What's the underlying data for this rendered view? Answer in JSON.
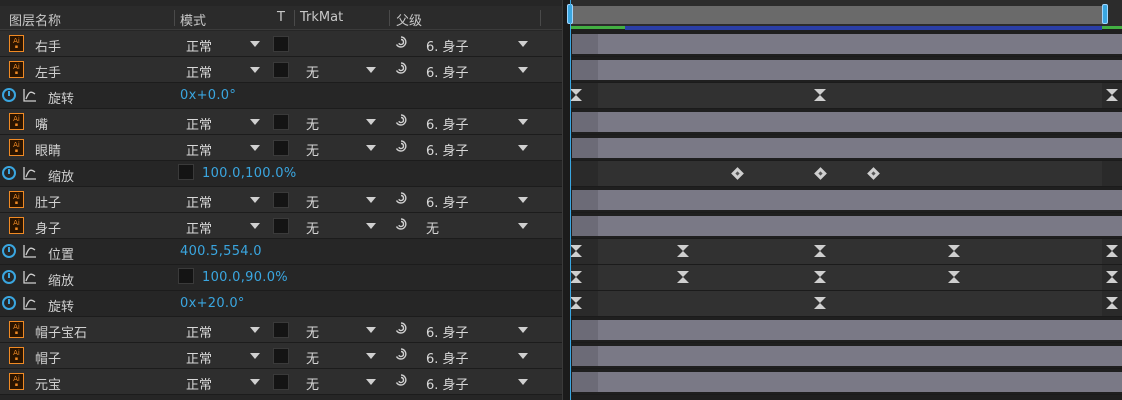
{
  "header": {
    "layer_name": "图层名称",
    "mode": "模式",
    "t": "T",
    "trkmat": "TrkMat",
    "parent": "父级"
  },
  "rows": [
    {
      "kind": "layer",
      "name": "右手",
      "mode": "正常",
      "trkmat": "",
      "parent": "6. 身子"
    },
    {
      "kind": "layer",
      "name": "左手",
      "mode": "正常",
      "trkmat": "无",
      "parent": "6. 身子"
    },
    {
      "kind": "prop",
      "name": "旋转",
      "value": "0x+0.0°",
      "chain": false,
      "keyframes": [
        {
          "t": 0.0,
          "shape": "hour"
        },
        {
          "t": 0.455,
          "shape": "hour"
        },
        {
          "t": 1.0,
          "shape": "hour"
        }
      ]
    },
    {
      "kind": "layer",
      "name": "嘴",
      "mode": "正常",
      "trkmat": "无",
      "parent": "6. 身子"
    },
    {
      "kind": "layer",
      "name": "眼睛",
      "mode": "正常",
      "trkmat": "无",
      "parent": "6. 身子"
    },
    {
      "kind": "prop",
      "name": "缩放",
      "value": "100.0,100.0%",
      "chain": true,
      "keyframes": [
        {
          "t": 0.3,
          "shape": "diamond"
        },
        {
          "t": 0.455,
          "shape": "diamond"
        },
        {
          "t": 0.555,
          "shape": "diamond"
        }
      ]
    },
    {
      "kind": "layer",
      "name": "肚子",
      "mode": "正常",
      "trkmat": "无",
      "parent": "6. 身子"
    },
    {
      "kind": "layer",
      "name": "身子",
      "mode": "正常",
      "trkmat": "无",
      "parent": "无"
    },
    {
      "kind": "prop",
      "name": "位置",
      "value": "400.5,554.0",
      "chain": false,
      "keyframes": [
        {
          "t": 0.0,
          "shape": "hour"
        },
        {
          "t": 0.2,
          "shape": "hour"
        },
        {
          "t": 0.455,
          "shape": "hour"
        },
        {
          "t": 0.705,
          "shape": "hour"
        },
        {
          "t": 1.0,
          "shape": "hour"
        }
      ]
    },
    {
      "kind": "prop",
      "name": "缩放",
      "value": "100.0,90.0%",
      "chain": true,
      "keyframes": [
        {
          "t": 0.0,
          "shape": "hour"
        },
        {
          "t": 0.2,
          "shape": "hour"
        },
        {
          "t": 0.455,
          "shape": "hour"
        },
        {
          "t": 0.705,
          "shape": "hour"
        },
        {
          "t": 1.0,
          "shape": "hour"
        }
      ]
    },
    {
      "kind": "prop",
      "name": "旋转",
      "value": "0x+20.0°",
      "chain": false,
      "keyframes": [
        {
          "t": 0.0,
          "shape": "hour"
        },
        {
          "t": 0.455,
          "shape": "hour"
        },
        {
          "t": 1.0,
          "shape": "hour"
        }
      ]
    },
    {
      "kind": "layer",
      "name": "帽子宝石",
      "mode": "正常",
      "trkmat": "无",
      "parent": "6. 身子"
    },
    {
      "kind": "layer",
      "name": "帽子",
      "mode": "正常",
      "trkmat": "无",
      "parent": "6. 身子"
    },
    {
      "kind": "layer",
      "name": "元宝",
      "mode": "正常",
      "trkmat": "无",
      "parent": "6. 身子"
    }
  ],
  "icons": {
    "layer": "illustrator-layer-icon",
    "stopwatch": "stopwatch-icon",
    "graph": "graph-editor-icon",
    "parent_pick": "pickwhip-icon"
  },
  "colors": {
    "value_blue": "#3aa6e0",
    "ai_orange": "#f08a24",
    "layer_bar": "#7a7986"
  }
}
